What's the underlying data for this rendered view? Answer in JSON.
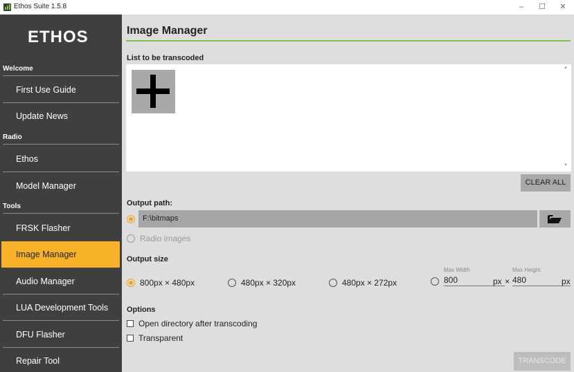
{
  "window": {
    "title": "Ethos Suite 1.5.8",
    "controls": {
      "minimize": "–",
      "maximize": "☐",
      "close": "✕"
    }
  },
  "sidebar": {
    "logo_text": "ETHOS",
    "sections": [
      {
        "label": "Welcome",
        "items": [
          {
            "label": "First Use Guide"
          },
          {
            "label": "Update News"
          }
        ]
      },
      {
        "label": "Radio",
        "items": [
          {
            "label": "Ethos"
          },
          {
            "label": "Model Manager"
          }
        ]
      },
      {
        "label": "Tools",
        "items": [
          {
            "label": "FRSK Flasher"
          },
          {
            "label": "Image Manager",
            "active": true
          },
          {
            "label": "Audio Manager"
          },
          {
            "label": "LUA Development Tools"
          },
          {
            "label": "DFU Flasher"
          },
          {
            "label": "Repair Tool"
          }
        ]
      }
    ]
  },
  "main": {
    "title": "Image Manager",
    "list_label": "List to be transcoded",
    "add_icon": "plus-icon",
    "clear_all_label": "CLEAR ALL",
    "output_path": {
      "label": "Output path:",
      "path_value": "F:\\bitmaps",
      "radio_images_label": "Radio images"
    },
    "output_size": {
      "label": "Output size",
      "options": [
        "800px × 480px",
        "480px × 320px",
        "480px × 272px"
      ],
      "selected_index": 0,
      "custom": {
        "max_width_label": "Max Width",
        "max_height_label": "Max Height",
        "width_value": "800",
        "height_value": "480",
        "unit": "px",
        "times": "×"
      }
    },
    "options": {
      "label": "Options",
      "open_directory_label": "Open directory after transcoding",
      "open_directory_checked": false,
      "transparent_label": "Transparent",
      "transparent_checked": false
    },
    "transcode_label": "TRANSCODE"
  },
  "colors": {
    "sidebar_bg": "#3f3f3f",
    "active_item": "#f7b229",
    "accent_green": "#7dc242",
    "radio_orange": "#f7a21b"
  }
}
